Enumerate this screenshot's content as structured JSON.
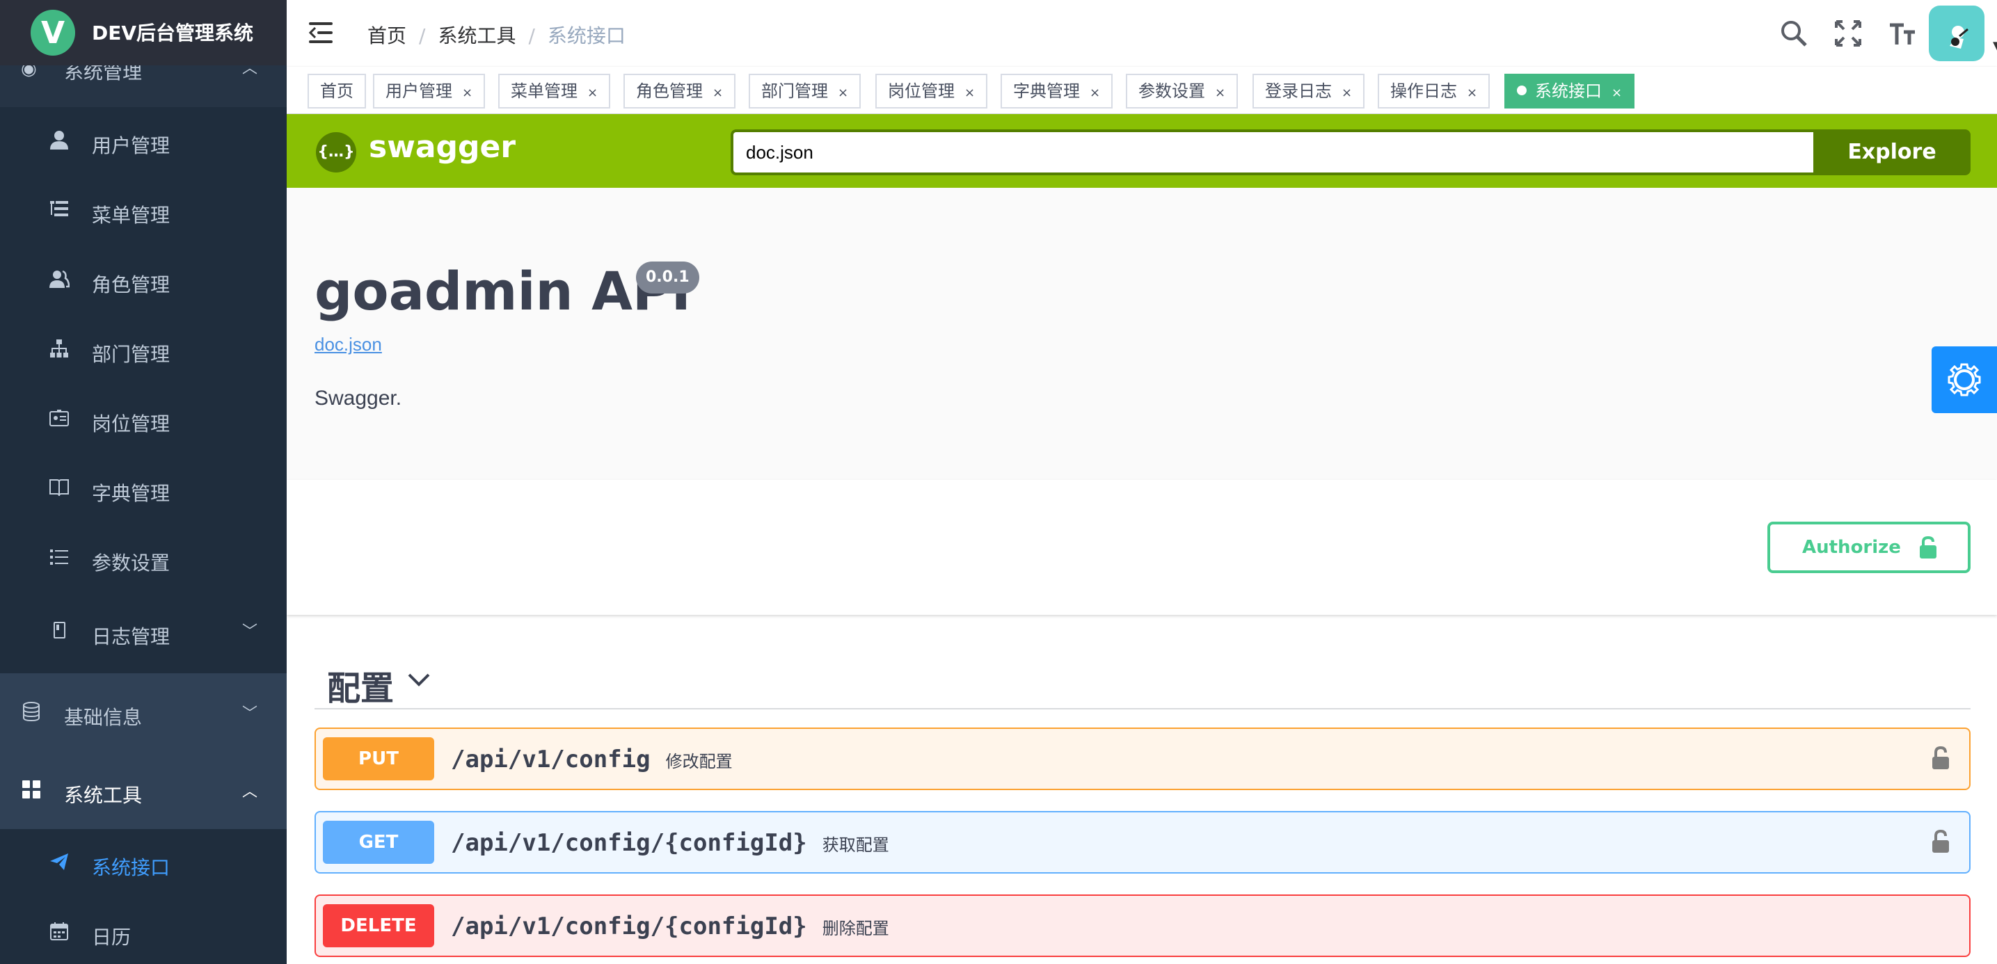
{
  "app": {
    "logo_letter": "V",
    "title": "DEV后台管理系统"
  },
  "sidebar": {
    "top_partial": {
      "label": "系统管理"
    },
    "system_items": [
      {
        "label": "用户管理",
        "icon": "user-icon"
      },
      {
        "label": "菜单管理",
        "icon": "tree-table-icon"
      },
      {
        "label": "角色管理",
        "icon": "peoples-icon"
      },
      {
        "label": "部门管理",
        "icon": "tree-icon"
      },
      {
        "label": "岗位管理",
        "icon": "post-icon"
      },
      {
        "label": "字典管理",
        "icon": "dict-icon"
      },
      {
        "label": "参数设置",
        "icon": "list-icon"
      },
      {
        "label": "日志管理",
        "icon": "log-icon"
      }
    ],
    "base_info": {
      "label": "基础信息"
    },
    "sys_tools": {
      "label": "系统工具"
    },
    "tool_items": [
      {
        "label": "系统接口",
        "icon": "send-icon",
        "active": true
      },
      {
        "label": "日历",
        "icon": "calendar-icon"
      }
    ]
  },
  "header": {
    "breadcrumb": [
      "首页",
      "系统工具",
      "系统接口"
    ]
  },
  "tags": [
    {
      "label": "首页",
      "closable": false
    },
    {
      "label": "用户管理",
      "closable": true
    },
    {
      "label": "菜单管理",
      "closable": true
    },
    {
      "label": "角色管理",
      "closable": true
    },
    {
      "label": "部门管理",
      "closable": true
    },
    {
      "label": "岗位管理",
      "closable": true
    },
    {
      "label": "字典管理",
      "closable": true
    },
    {
      "label": "参数设置",
      "closable": true
    },
    {
      "label": "登录日志",
      "closable": true
    },
    {
      "label": "操作日志",
      "closable": true
    },
    {
      "label": "系统接口",
      "closable": true,
      "active": true
    }
  ],
  "swagger": {
    "logo_text": "swagger",
    "logo_glyph": "{…}",
    "url": "doc.json",
    "explore_label": "Explore",
    "title": "goadmin API",
    "version": "0.0.1",
    "doc_link": "doc.json",
    "description": "Swagger.",
    "authorize_label": "Authorize",
    "tag_name": "配置",
    "operations": [
      {
        "method": "PUT",
        "path": "/api/v1/config",
        "summary": "修改配置"
      },
      {
        "method": "GET",
        "path": "/api/v1/config/{configId}",
        "summary": "获取配置"
      },
      {
        "method": "DELETE",
        "path": "/api/v1/config/{configId}",
        "summary": "删除配置"
      }
    ]
  },
  "colors": {
    "sidebar_bg": "#304156",
    "submenu_bg": "#1f2d3d",
    "active_blue": "#409eff",
    "tag_active": "#42b983",
    "swagger_green": "#89bf04",
    "put": "#fca130",
    "get": "#61affe",
    "delete": "#f93e3e"
  }
}
